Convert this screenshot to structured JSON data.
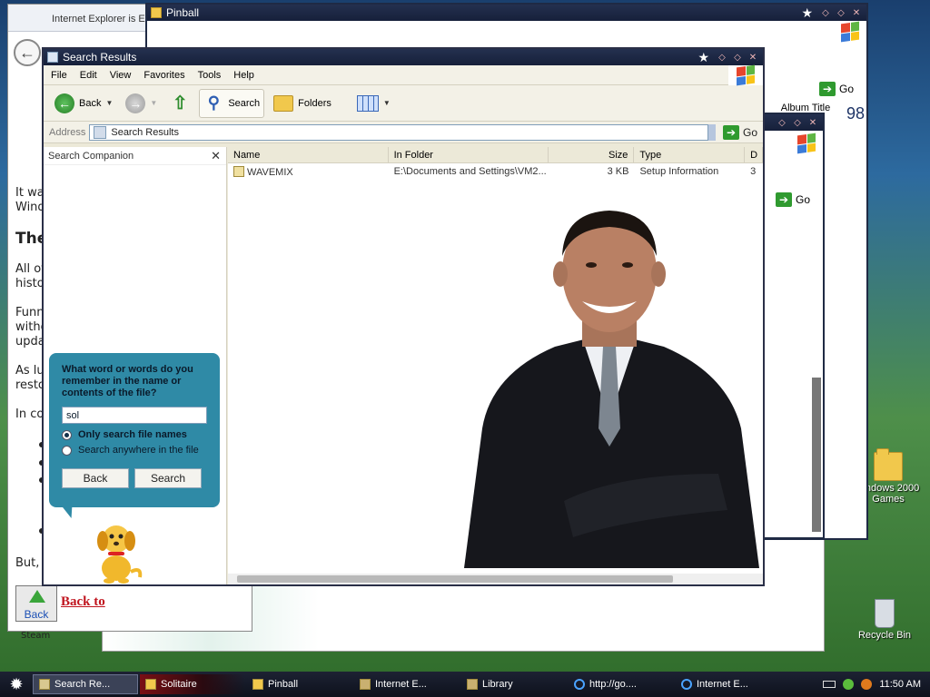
{
  "desktop": {
    "icons": [
      {
        "label": "...ndows 2000 Games",
        "kind": "folder"
      },
      {
        "label": "Recycle Bin",
        "kind": "bin"
      }
    ]
  },
  "ie_window": {
    "title": "Internet Explorer is E",
    "lines": [
      "It wa",
      "Wind",
      "The",
      "All of",
      "histo",
      "Funn",
      "witho",
      "upda",
      "As lu",
      "resto",
      "In co",
      "But,"
    ],
    "back_button_label": "Back",
    "back_link": "Back to",
    "left_edge_text": "Steam"
  },
  "pinball_window": {
    "title": "Pinball",
    "go_label": "Go",
    "column_header": "Album Title",
    "side_number": "98"
  },
  "solitaire_window": {
    "go_label": "Go"
  },
  "search_window": {
    "title": "Search Results",
    "menu": [
      "File",
      "Edit",
      "View",
      "Favorites",
      "Tools",
      "Help"
    ],
    "toolbar": {
      "back": "Back",
      "search": "Search",
      "folders": "Folders"
    },
    "address": {
      "label": "Address",
      "value": "Search Results",
      "go": "Go"
    },
    "companion": {
      "header": "Search Companion",
      "question": "What word or words do you remember in the name or contents of the file?",
      "input_value": "sol",
      "option1": "Only search file names",
      "option2": "Search anywhere in the file",
      "back_button": "Back",
      "search_button": "Search"
    },
    "columns": [
      "Name",
      "In Folder",
      "Size",
      "Type",
      "D"
    ],
    "rows": [
      {
        "name": "WAVEMIX",
        "folder": "E:\\Documents and Settings\\VM2...",
        "size": "3 KB",
        "type": "Setup Information",
        "date": "3"
      }
    ]
  },
  "taskbar": {
    "tasks": [
      {
        "label": "Search Re...",
        "icon": "search-window-icon",
        "active": true
      },
      {
        "label": "Solitaire",
        "icon": "folder-icon",
        "active": false
      },
      {
        "label": "Pinball",
        "icon": "folder-icon",
        "active": false
      },
      {
        "label": "Internet E...",
        "icon": "ie-icon",
        "active": false
      },
      {
        "label": "Library",
        "icon": "library-icon",
        "active": false
      },
      {
        "label": "http://go....",
        "icon": "ie-icon",
        "active": false
      },
      {
        "label": "Internet E...",
        "icon": "ie-icon",
        "active": false
      }
    ],
    "clock": "11:50 AM"
  }
}
